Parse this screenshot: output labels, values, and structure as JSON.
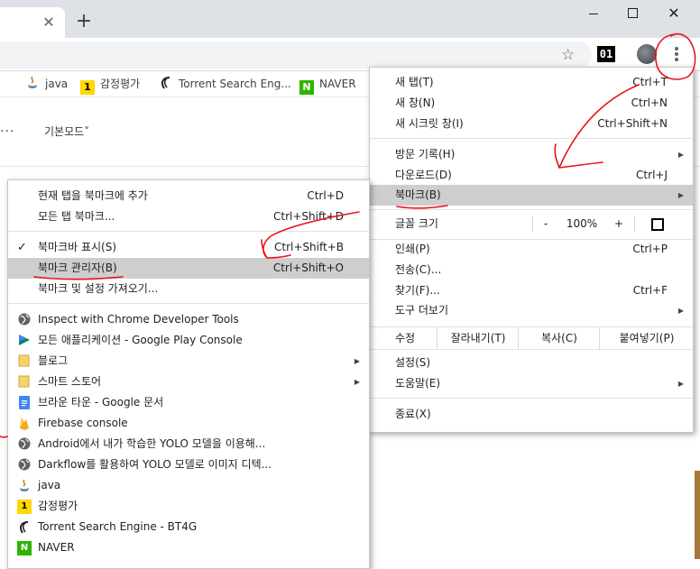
{
  "tab_bar": {
    "new_tab_glyph": "+",
    "close_glyph": "✕"
  },
  "bookmarks_bar": [
    {
      "label": "java",
      "icon": "java-icon"
    },
    {
      "label": "감정평가",
      "icon": "number-one-icon",
      "icon_text": "1"
    },
    {
      "label": "Torrent Search Eng...",
      "icon": "torrent-icon"
    },
    {
      "label": "NAVER",
      "icon": "naver-icon",
      "icon_text": "N"
    }
  ],
  "ext_badge": "01",
  "page": {
    "more": "···",
    "mode_label": "기본모드",
    "mode_arrow": "˅"
  },
  "chrome_menu": {
    "new_tab": {
      "label": "새 탭(T)",
      "shortcut": "Ctrl+T"
    },
    "new_window": {
      "label": "새 창(N)",
      "shortcut": "Ctrl+N"
    },
    "incognito": {
      "label": "새 시크릿 창(I)",
      "shortcut": "Ctrl+Shift+N"
    },
    "history": {
      "label": "방문 기록(H)"
    },
    "downloads": {
      "label": "다운로드(D)",
      "shortcut": "Ctrl+J"
    },
    "bookmarks": {
      "label": "북마크(B)"
    },
    "zoom": {
      "label": "글꼴 크기",
      "minus": "-",
      "value": "100%",
      "plus": "+"
    },
    "print": {
      "label": "인쇄(P)",
      "shortcut": "Ctrl+P"
    },
    "cast": {
      "label": "전송(C)..."
    },
    "find": {
      "label": "찾기(F)...",
      "shortcut": "Ctrl+F"
    },
    "more_tools": {
      "label": "도구 더보기"
    },
    "edit": {
      "label": "수정",
      "cut": "잘라내기(T)",
      "copy": "복사(C)",
      "paste": "붙여넣기(P)"
    },
    "settings": {
      "label": "설정(S)"
    },
    "help": {
      "label": "도움말(E)"
    },
    "exit": {
      "label": "종료(X)"
    }
  },
  "bookmark_menu": {
    "add_current": {
      "label": "현재 탭을 북마크에 추가",
      "shortcut": "Ctrl+D"
    },
    "bookmark_all": {
      "label": "모든 탭 북마크...",
      "shortcut": "Ctrl+Shift+D"
    },
    "show_bar": {
      "label": "북마크바 표시(S)",
      "shortcut": "Ctrl+Shift+B",
      "checked": "✓"
    },
    "manager": {
      "label": "북마크 관리자(B)",
      "shortcut": "Ctrl+Shift+O"
    },
    "import": {
      "label": "북마크 및 설정 가져오기..."
    },
    "items": [
      {
        "label": "Inspect with Chrome Developer Tools",
        "icon": "globe-icon"
      },
      {
        "label": "모든 애플리케이션 - Google Play Console",
        "icon": "play-console-icon"
      },
      {
        "label": "블로그",
        "icon": "folder-icon",
        "submenu": true
      },
      {
        "label": "스마트 스토어",
        "icon": "folder-icon",
        "submenu": true
      },
      {
        "label": "브라운 타운 - Google 문서",
        "icon": "google-docs-icon"
      },
      {
        "label": "Firebase console",
        "icon": "firebase-icon"
      },
      {
        "label": "Android에서 내가 학습한 YOLO 모델을 이용해...",
        "icon": "globe-icon"
      },
      {
        "label": "Darkflow를 활용하여 YOLO 모델로 이미지 디텍...",
        "icon": "globe-icon"
      },
      {
        "label": "java",
        "icon": "java-icon"
      },
      {
        "label": "감정평가",
        "icon": "number-one-icon",
        "icon_text": "1"
      },
      {
        "label": "Torrent Search Engine - BT4G",
        "icon": "torrent-icon"
      },
      {
        "label": "NAVER",
        "icon": "naver-icon",
        "icon_text": "N"
      }
    ]
  },
  "colors": {
    "highlight": "#cecece",
    "annotation": "#e8131b",
    "chrome_strip": "#dee1e6",
    "naver_green": "#2db400",
    "number_one_yellow": "#ffd800",
    "folder_yellow": "#f5d26b",
    "docs_blue": "#4285f4",
    "firebase_orange": "#f5a623"
  }
}
